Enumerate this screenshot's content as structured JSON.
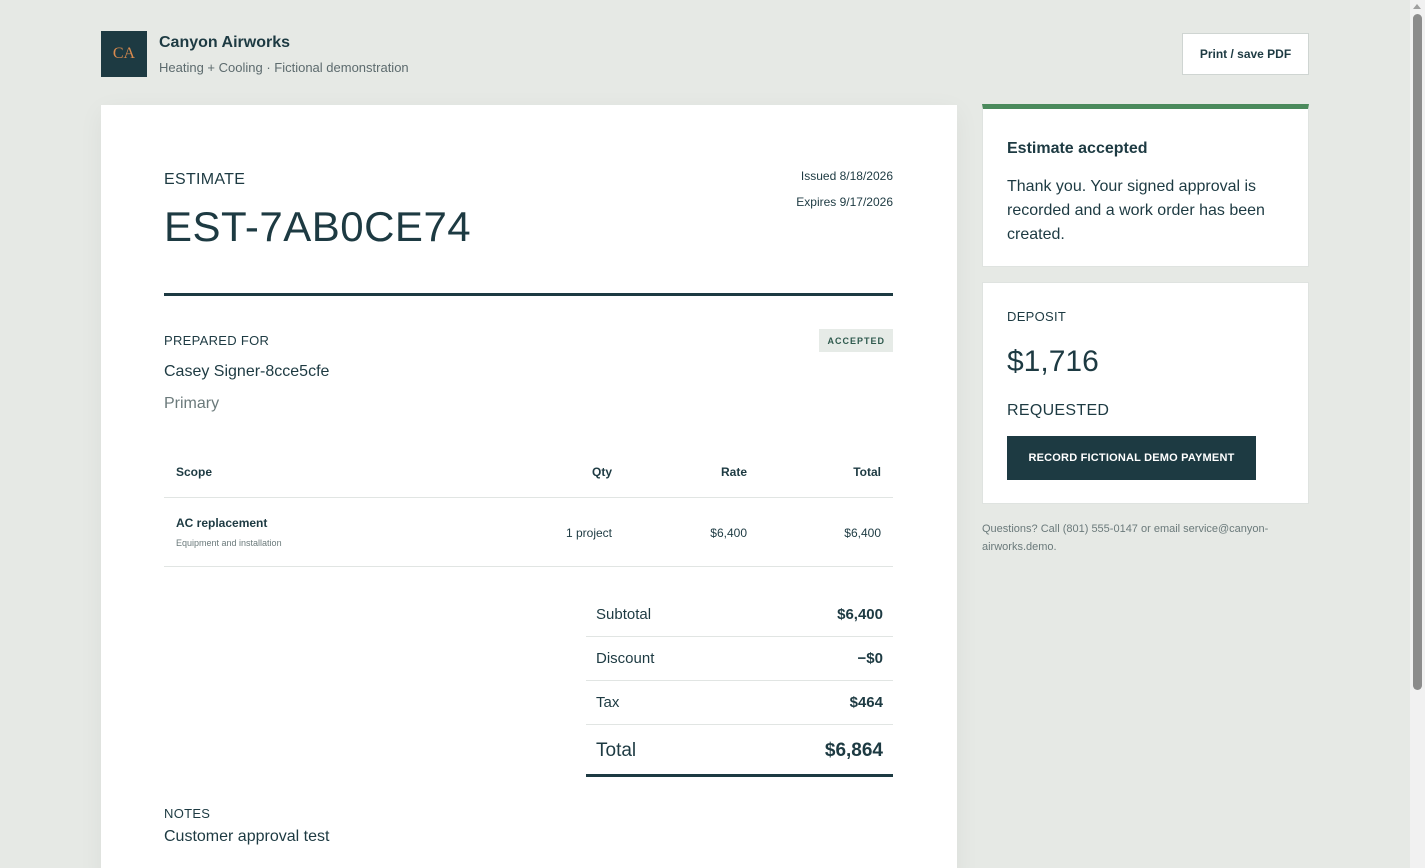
{
  "brand": {
    "logo_text": "CA",
    "name": "Canyon Airworks",
    "subtitle": "Heating + Cooling · Fictional demonstration"
  },
  "toolbar": {
    "print_label": "Print / save PDF"
  },
  "estimate": {
    "label": "ESTIMATE",
    "number": "EST-7AB0CE74",
    "issued": "Issued 8/18/2026",
    "expires": "Expires 9/17/2026",
    "status_badge": "ACCEPTED",
    "prepared_for_label": "PREPARED FOR",
    "customer_name": "Casey Signer-8cce5cfe",
    "customer_tag": "Primary"
  },
  "table": {
    "headers": {
      "scope": "Scope",
      "qty": "Qty",
      "rate": "Rate",
      "total": "Total"
    },
    "rows": [
      {
        "scope": "AC replacement",
        "desc": "Equipment and installation",
        "qty": "1 project",
        "rate": "$6,400",
        "total": "$6,400"
      }
    ]
  },
  "totals": {
    "subtotal_label": "Subtotal",
    "subtotal": "$6,400",
    "discount_label": "Discount",
    "discount": "−$0",
    "tax_label": "Tax",
    "tax": "$464",
    "total_label": "Total",
    "total": "$6,864"
  },
  "notes": {
    "label": "NOTES",
    "text": "Customer approval test"
  },
  "acceptance": {
    "title": "Estimate accepted",
    "body": "Thank you. Your signed approval is recorded and a work order has been created."
  },
  "deposit": {
    "label": "DEPOSIT",
    "amount": "$1,716",
    "status": "REQUESTED",
    "button_label": "RECORD FICTIONAL DEMO PAYMENT"
  },
  "contact": {
    "text": "Questions? Call (801) 555-0147 or email service@canyon-airworks.demo."
  },
  "colors": {
    "primary": "#1d3a42",
    "accent_green": "#4b8a5c",
    "logo_text": "#d98a4e",
    "background": "#e6e9e5"
  }
}
